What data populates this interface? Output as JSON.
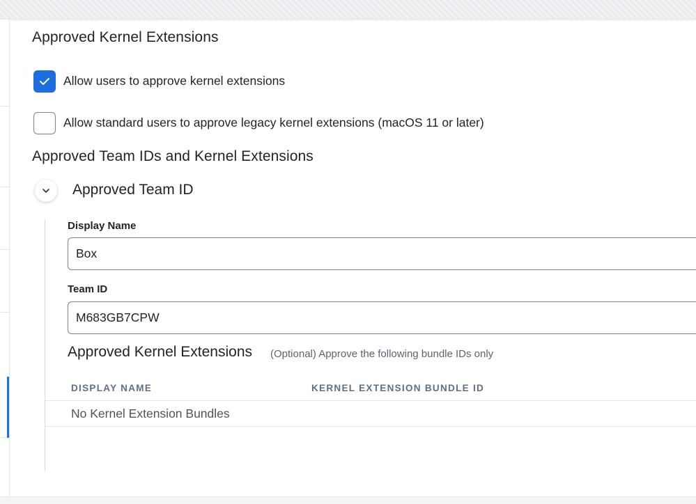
{
  "kernel_section": {
    "title": "Approved Kernel Extensions",
    "options": [
      {
        "label": "Allow users to approve kernel extensions",
        "checked": true
      },
      {
        "label": "Allow standard users to approve legacy kernel extensions (macOS 11 or later)",
        "checked": false
      }
    ]
  },
  "team_section": {
    "title": "Approved Team IDs and Kernel Extensions",
    "group": {
      "title": "Approved Team ID",
      "expanded": true,
      "display_name_label": "Display Name",
      "display_name_value": "Box",
      "team_id_label": "Team ID",
      "team_id_value": "M683GB7CPW",
      "extensions": {
        "title": "Approved Kernel Extensions",
        "hint": "(Optional) Approve the following bundle IDs only",
        "columns": [
          "DISPLAY NAME",
          "KERNEL EXTENSION BUNDLE ID"
        ],
        "empty_text": "No Kernel Extension Bundles"
      }
    }
  },
  "colors": {
    "accent": "#1d6fe0",
    "text": "#1f2329",
    "table_header": "#5b6f87"
  },
  "icons": {
    "checked_box": "checkmark-icon",
    "expand_toggle": "chevron-down-icon"
  }
}
